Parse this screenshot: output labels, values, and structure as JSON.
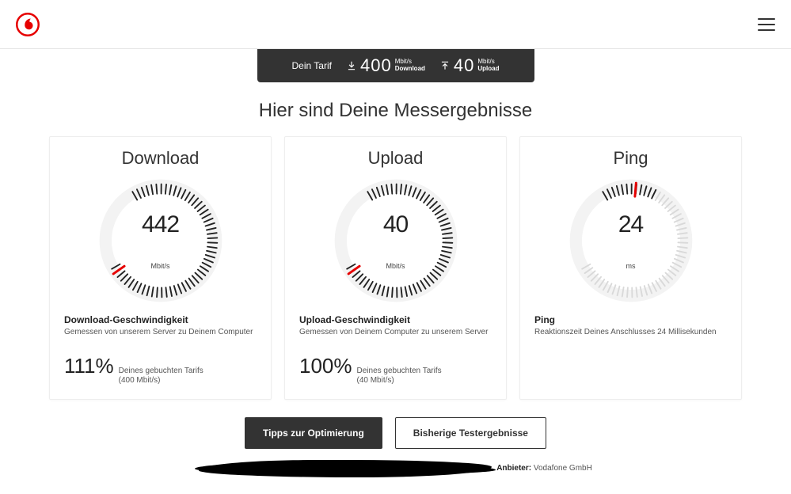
{
  "tarif": {
    "label": "Dein Tarif",
    "download_value": "400",
    "download_unit_top": "Mbit/s",
    "download_unit_bottom": "Download",
    "upload_value": "40",
    "upload_unit_top": "Mbit/s",
    "upload_unit_bottom": "Upload"
  },
  "page_title": "Hier sind Deine Messergebnisse",
  "cards": {
    "download": {
      "title": "Download",
      "value": "442",
      "unit": "Mbit/s",
      "metric_title": "Download-Geschwindigkeit",
      "metric_desc": "Gemessen von unserem Server zu Deinem Computer",
      "percent": "111%",
      "percent_desc_1": "Deines gebuchten Tarifs",
      "percent_desc_2": "(400 Mbit/s)"
    },
    "upload": {
      "title": "Upload",
      "value": "40",
      "unit": "Mbit/s",
      "metric_title": "Upload-Geschwindigkeit",
      "metric_desc": "Gemessen von Deinem Computer zu unserem Server",
      "percent": "100%",
      "percent_desc_1": "Deines gebuchten Tarifs",
      "percent_desc_2": "(40 Mbit/s)"
    },
    "ping": {
      "title": "Ping",
      "value": "24",
      "unit": "ms",
      "metric_title": "Ping",
      "metric_desc": "Reaktionszeit Deines Anschlusses 24 Millisekunden"
    }
  },
  "buttons": {
    "optimize": "Tipps zur Optimierung",
    "history": "Bisherige Testergebnisse"
  },
  "footer": {
    "provider_label": "Anbieter:",
    "provider_name": "Vodafone GmbH"
  },
  "chart_data": [
    {
      "type": "gauge",
      "name": "download",
      "value": 442,
      "unit": "Mbit/s",
      "fill_fraction": 1.0,
      "indicator_angle_deg": 145
    },
    {
      "type": "gauge",
      "name": "upload",
      "value": 40,
      "unit": "Mbit/s",
      "fill_fraction": 1.0,
      "indicator_angle_deg": 145
    },
    {
      "type": "gauge",
      "name": "ping",
      "value": 24,
      "unit": "ms",
      "fill_fraction": 0.22,
      "indicator_angle_deg": -85
    }
  ]
}
